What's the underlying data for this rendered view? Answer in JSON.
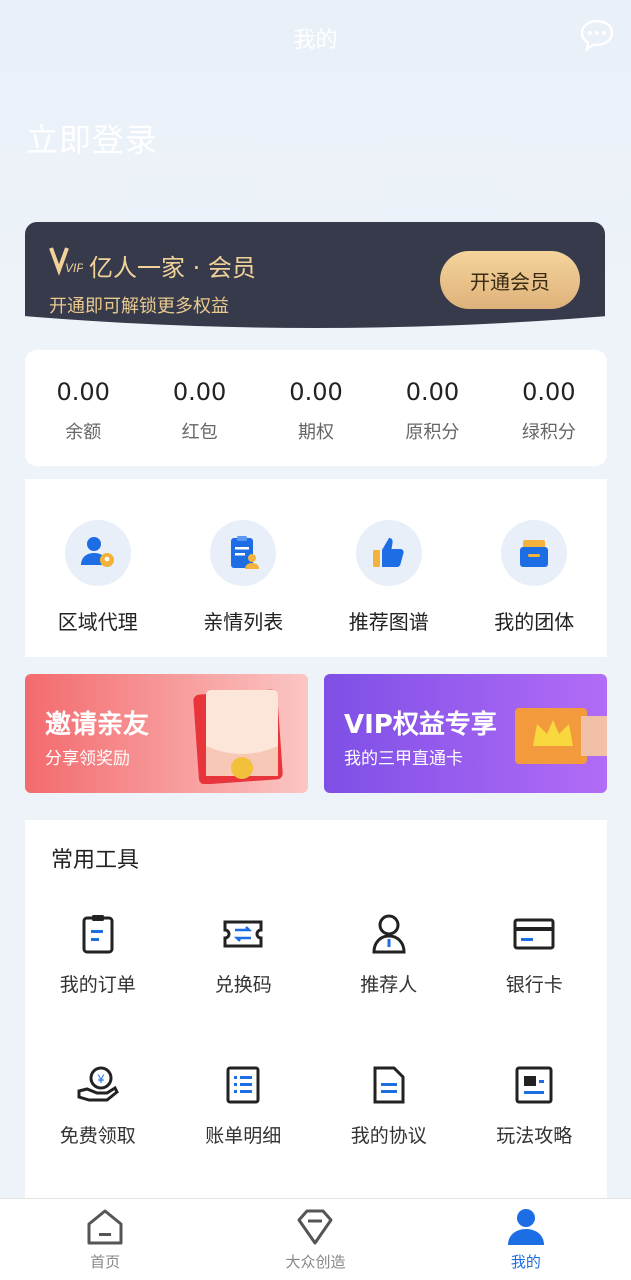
{
  "header": {
    "title": "我的",
    "login_text": "立即登录",
    "message_icon": "chat-bubble-icon"
  },
  "vip": {
    "title": "亿人一家 · 会员",
    "subtitle": "开通即可解锁更多权益",
    "button": "开通会员",
    "logo_text": "VIP"
  },
  "stats": [
    {
      "value": "0.00",
      "label": "余额"
    },
    {
      "value": "0.00",
      "label": "红包"
    },
    {
      "value": "0.00",
      "label": "期权"
    },
    {
      "value": "0.00",
      "label": "原积分"
    },
    {
      "value": "0.00",
      "label": "绿积分"
    }
  ],
  "quick": [
    {
      "label": "区域代理",
      "icon": "agent-location-icon"
    },
    {
      "label": "亲情列表",
      "icon": "clipboard-user-icon"
    },
    {
      "label": "推荐图谱",
      "icon": "thumbs-up-icon"
    },
    {
      "label": "我的团体",
      "icon": "group-box-icon"
    }
  ],
  "banners": {
    "invite": {
      "title": "邀请亲友",
      "subtitle": "分享领奖励"
    },
    "vip": {
      "title": "VIP权益专享",
      "subtitle": "我的三甲直通卡"
    }
  },
  "tools": {
    "title": "常用工具",
    "items": [
      {
        "label": "我的订单",
        "icon": "order-clipboard-icon"
      },
      {
        "label": "兑换码",
        "icon": "exchange-ticket-icon"
      },
      {
        "label": "推荐人",
        "icon": "referrer-person-icon"
      },
      {
        "label": "银行卡",
        "icon": "bank-card-icon"
      },
      {
        "label": "免费领取",
        "icon": "free-coin-hand-icon"
      },
      {
        "label": "账单明细",
        "icon": "bill-list-icon"
      },
      {
        "label": "我的协议",
        "icon": "agreement-doc-icon"
      },
      {
        "label": "玩法攻略",
        "icon": "guide-icon"
      }
    ]
  },
  "tabbar": [
    {
      "label": "首页",
      "icon": "home-icon",
      "active": false
    },
    {
      "label": "大众创造",
      "icon": "diamond-icon",
      "active": false
    },
    {
      "label": "我的",
      "icon": "user-icon",
      "active": true
    }
  ],
  "colors": {
    "accent": "#1d6de4",
    "vip_bg": "#363a4b",
    "vip_gold": "#f1d39a"
  }
}
